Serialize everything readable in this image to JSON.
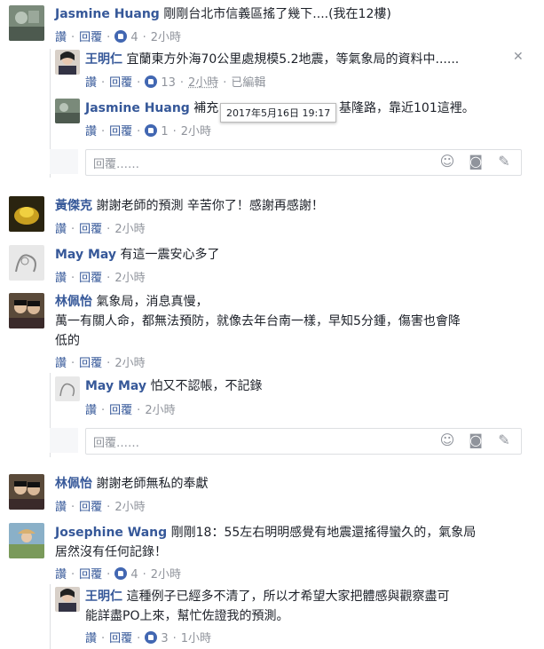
{
  "actions": {
    "like": "讚",
    "reply": "回覆",
    "edited": "已編輯"
  },
  "reply_placeholder": "回覆……",
  "tooltip": "2017年5月16日 19:17",
  "comments": [
    {
      "name": "Jasmine Huang",
      "text": "剛剛台北市信義區搖了幾下....(我在12樓)",
      "likes": "4",
      "time": "2小時"
    },
    {
      "name": "王明仁",
      "text": "宜蘭東方外海70公里處規模5.2地震，等氣象局的資料中......",
      "likes": "13",
      "time": "2小時"
    },
    {
      "name": "Jasmine Huang",
      "text_a": "補充",
      "text_b": "基隆路，靠近101這裡。",
      "likes": "1",
      "time": "2小時"
    },
    {
      "name": "黃傑克",
      "text": "謝謝老師的預測 辛苦你了！感謝再感謝！",
      "time": "2小時"
    },
    {
      "name": "May May",
      "text": "有這一震安心多了",
      "time": "2小時"
    },
    {
      "name": "林佩怡",
      "text_l1": "氣象局，消息真慢，",
      "text_l2": "萬一有關人命，都無法預防，就像去年台南一樣，早知5分鍾，傷害也會降",
      "text_l3": "低的",
      "time": "2小時"
    },
    {
      "name": "May May",
      "text": "怕又不認帳，不記錄",
      "time": "2小時"
    },
    {
      "name": "林佩怡",
      "text": "謝謝老師無私的奉獻",
      "time": "2小時"
    },
    {
      "name": "Josephine Wang",
      "text_l1": "剛剛18：55左右明明感覺有地震還搖得蠻久的，氣象局",
      "text_l2": "居然沒有任何記錄！",
      "likes": "4",
      "time": "2小時"
    },
    {
      "name": "王明仁",
      "text_l1": "這種例子已經多不清了，所以才希望大家把體感與觀察盡可",
      "text_l2": "能詳盡PO上來，幫忙佐證我的預測。",
      "likes": "3",
      "time": "1小時"
    }
  ]
}
